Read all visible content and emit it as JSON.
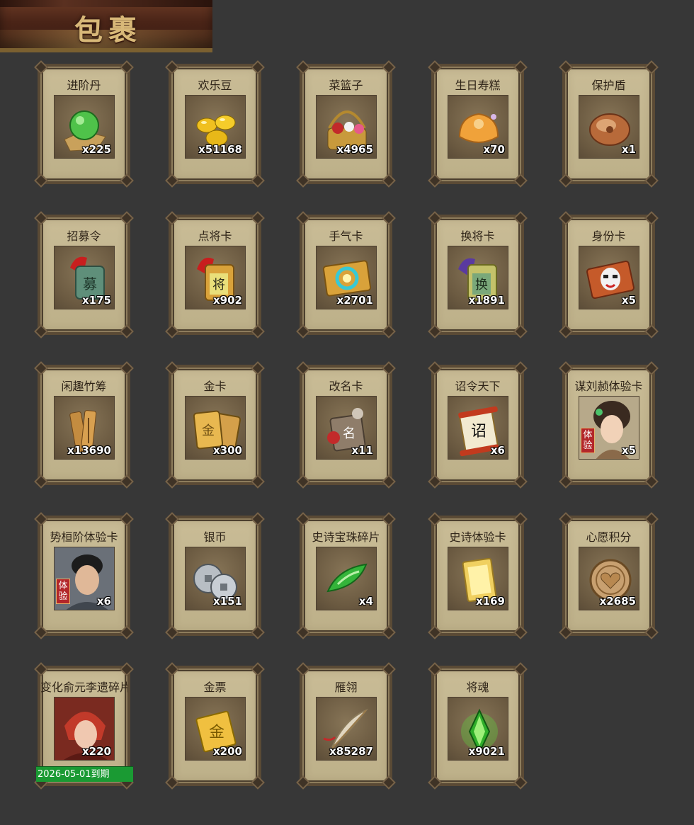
{
  "title": "包裹",
  "items": [
    {
      "name": "进阶丹",
      "count": "x225",
      "icon": "green-orb-icon"
    },
    {
      "name": "欢乐豆",
      "count": "x51168",
      "icon": "gold-beans-icon"
    },
    {
      "name": "菜篮子",
      "count": "x4965",
      "icon": "flower-basket-icon"
    },
    {
      "name": "生日寿糕",
      "count": "x70",
      "icon": "birthday-cake-icon"
    },
    {
      "name": "保护盾",
      "count": "x1",
      "icon": "shield-icon"
    },
    {
      "name": "招募令",
      "count": "x175",
      "icon": "recruit-token-icon"
    },
    {
      "name": "点将卡",
      "count": "x902",
      "icon": "general-card-icon"
    },
    {
      "name": "手气卡",
      "count": "x2701",
      "icon": "luck-card-icon"
    },
    {
      "name": "换将卡",
      "count": "x1891",
      "icon": "swap-general-card-icon"
    },
    {
      "name": "身份卡",
      "count": "x5",
      "icon": "identity-mask-icon"
    },
    {
      "name": "闲趣竹筹",
      "count": "x13690",
      "icon": "bamboo-tally-icon"
    },
    {
      "name": "金卡",
      "count": "x300",
      "icon": "gold-card-icon"
    },
    {
      "name": "改名卡",
      "count": "x11",
      "icon": "rename-card-icon"
    },
    {
      "name": "诏令天下",
      "count": "x6",
      "icon": "edict-scroll-icon"
    },
    {
      "name": "谋刘赪体验卡",
      "count": "x5",
      "icon": "heroine-portrait-icon",
      "badge": "体验"
    },
    {
      "name": "势桓阶体验卡",
      "count": "x6",
      "icon": "hero-portrait-icon",
      "badge": "体验"
    },
    {
      "name": "银币",
      "count": "x151",
      "icon": "silver-coins-icon"
    },
    {
      "name": "史诗宝珠碎片",
      "count": "x4",
      "icon": "jade-shard-icon"
    },
    {
      "name": "史诗体验卡",
      "count": "x169",
      "icon": "epic-card-icon"
    },
    {
      "name": "心愿积分",
      "count": "x2685",
      "icon": "heart-coin-icon"
    },
    {
      "name": "变化俞元李遗碎片",
      "count": "x220",
      "icon": "warrior-portrait-icon",
      "expiry": "2026-05-01到期"
    },
    {
      "name": "金票",
      "count": "x200",
      "icon": "gold-ticket-icon"
    },
    {
      "name": "雁翎",
      "count": "x85287",
      "icon": "feather-icon"
    },
    {
      "name": "将魂",
      "count": "x9021",
      "icon": "soul-crystal-icon"
    }
  ]
}
